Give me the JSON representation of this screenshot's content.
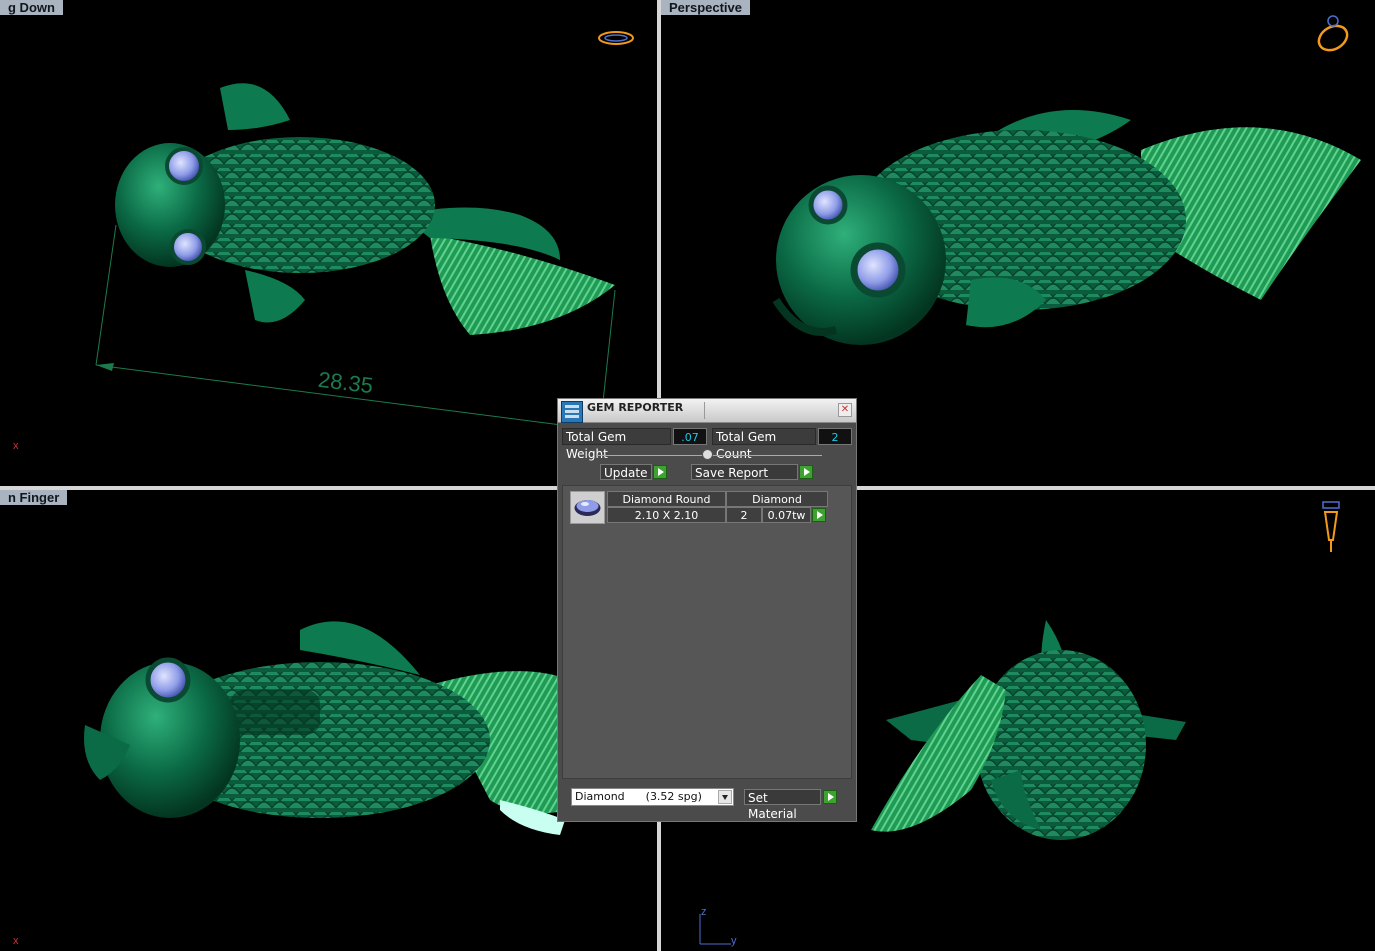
{
  "viewports": {
    "top_left": {
      "label": "g Down",
      "axis": "x",
      "dimension": "28.35"
    },
    "top_right": {
      "label": "Perspective"
    },
    "bottom_left": {
      "label": "n Finger",
      "axis": "x"
    },
    "bottom_right": {
      "label": "",
      "axis_z": "z",
      "axis_y": "y"
    }
  },
  "gem_reporter": {
    "title": "GEM REPORTER",
    "close_icon": "close-icon",
    "total_gem_weight_label": "Total Gem Weight",
    "total_gem_weight_value": ".07",
    "total_gem_count_label": "Total Gem Count",
    "total_gem_count_value": "2",
    "update_label": "Update",
    "save_report_label": "Save Report",
    "gems": [
      {
        "shape": "Diamond Round",
        "size": "2.10 X 2.10",
        "material": "Diamond",
        "count": "2",
        "weight": "0.07tw"
      }
    ],
    "material_select": "Diamond      (3.52 spg)",
    "set_material_label": "Set Material"
  },
  "colors": {
    "model_green": "#0b6b46",
    "gem_blue": "#8f9de8",
    "viewport_label_bg": "#aab3c0",
    "dialog_bg": "#4b4b4b",
    "value_cyan": "#1ec8e8",
    "play_green": "#3da32f"
  }
}
